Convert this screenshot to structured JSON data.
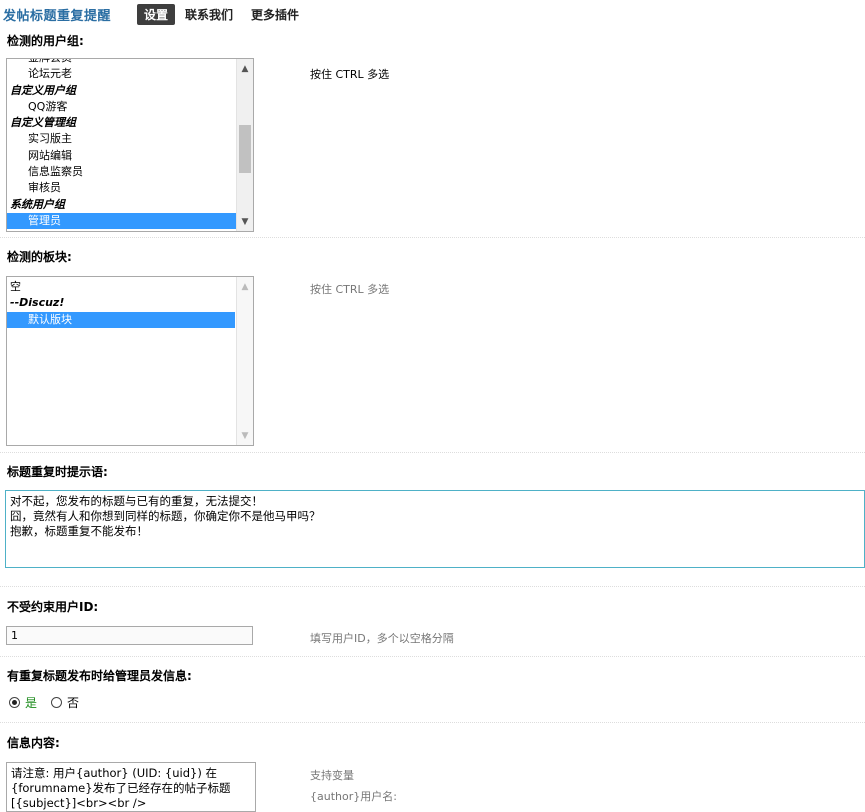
{
  "header": {
    "title": "发帖标题重复提醒",
    "tabs": [
      {
        "label": "设置",
        "active": true
      },
      {
        "label": "联系我们",
        "active": false
      },
      {
        "label": "更多插件",
        "active": false
      }
    ]
  },
  "user_groups": {
    "label": "检测的用户组:",
    "hint": "按住 CTRL 多选",
    "options": [
      {
        "text": "金牌会员",
        "type": "option",
        "selected": false
      },
      {
        "text": "论坛元老",
        "type": "option",
        "selected": false
      },
      {
        "text": "自定义用户组",
        "type": "group",
        "selected": false
      },
      {
        "text": "QQ游客",
        "type": "option",
        "selected": false
      },
      {
        "text": "自定义管理组",
        "type": "group",
        "selected": false
      },
      {
        "text": "实习版主",
        "type": "option",
        "selected": false
      },
      {
        "text": "网站编辑",
        "type": "option",
        "selected": false
      },
      {
        "text": "信息监察员",
        "type": "option",
        "selected": false
      },
      {
        "text": "审核员",
        "type": "option",
        "selected": false
      },
      {
        "text": "系统用户组",
        "type": "group",
        "selected": false
      },
      {
        "text": "管理员",
        "type": "option",
        "selected": true
      }
    ]
  },
  "forums": {
    "label": "检测的板块:",
    "hint": "按住 CTRL 多选",
    "options": [
      {
        "text": "空",
        "type": "plain",
        "selected": false
      },
      {
        "text": "--Discuz!",
        "type": "group",
        "selected": false
      },
      {
        "text": "默认版块",
        "type": "option",
        "selected": true
      }
    ]
  },
  "dup_message": {
    "label": "标题重复时提示语:",
    "value": "对不起，您发布的标题与已有的重复，无法提交！\n囧，竟然有人和你想到同样的标题，你确定你不是他马甲吗？\n抱歉，标题重复不能发布！"
  },
  "exempt_users": {
    "label": "不受约束用户ID:",
    "value": "1",
    "hint": "填写用户ID，多个以空格分隔"
  },
  "notify_admin": {
    "label": "有重复标题发布时给管理员发信息:",
    "yes": "是",
    "no": "否",
    "selected": "yes"
  },
  "message_content": {
    "label": "信息内容:",
    "value": "请注意: 用户{author} (UID: {uid}) 在{forumname}发布了已经存在的帖子标题[{subject}]<br><br />",
    "hint_title": "支持变量",
    "hint_line1": "{author}用户名:"
  },
  "colors": {
    "title": "#2b6ea3",
    "selected": "#3399ff",
    "active_tab": "#3e3e3e",
    "radio_yes": "#1a8a1a",
    "textarea_focus": "#4eb1c7"
  }
}
